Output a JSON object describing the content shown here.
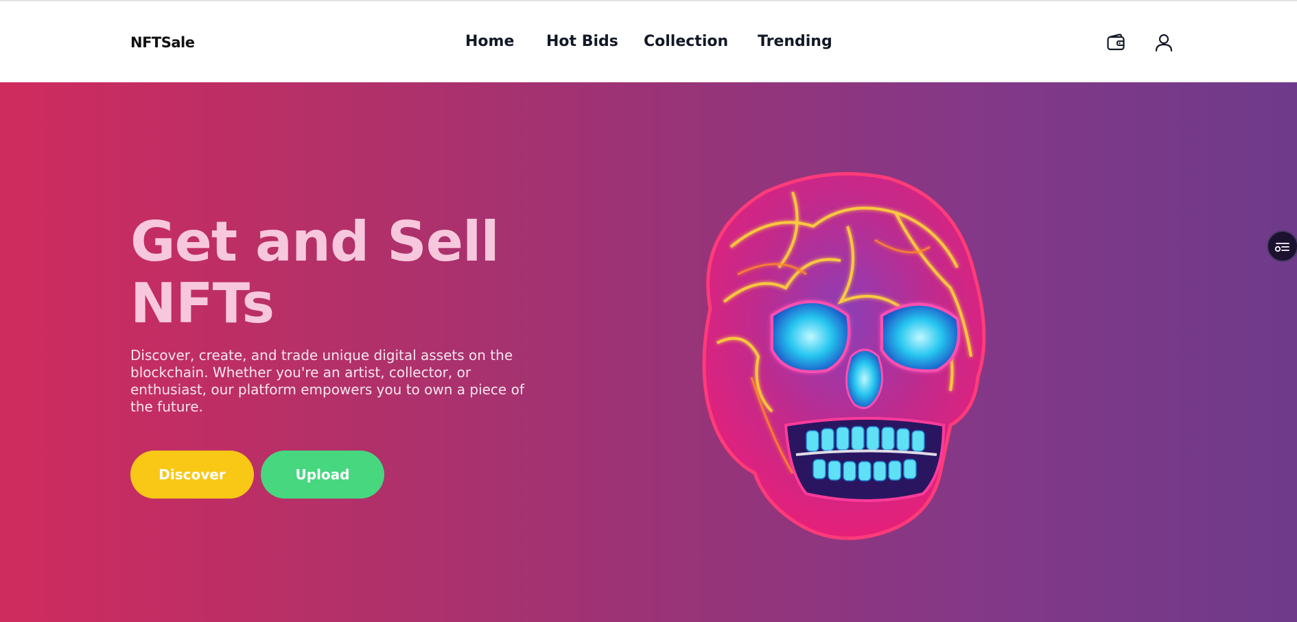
{
  "nav": {
    "logo": "NFTSale",
    "links": [
      "Home",
      "Hot Bids",
      "Collection",
      "Trending"
    ],
    "icons": [
      "wallet-icon",
      "user-icon"
    ]
  },
  "hero": {
    "title_line1": "Get and Sell",
    "title_line2": "NFTs",
    "description": "Discover, create, and trade unique digital assets on the blockchain. Whether you're an artist, collector, or enthusiast, our platform empowers you to own a piece of the future.",
    "buttons": {
      "discover": "Discover",
      "upload": "Upload"
    },
    "image": "neon-skull-nft-image"
  },
  "side_widget": {
    "icon": "settings-list-icon"
  },
  "colors": {
    "hero_gradient_start": "#cf2b5e",
    "hero_gradient_end": "#6f3a8b",
    "title_color": "#f7c8dd",
    "discover_button": "#f9c817",
    "upload_button": "#46d77f",
    "nav_text": "#121826"
  }
}
